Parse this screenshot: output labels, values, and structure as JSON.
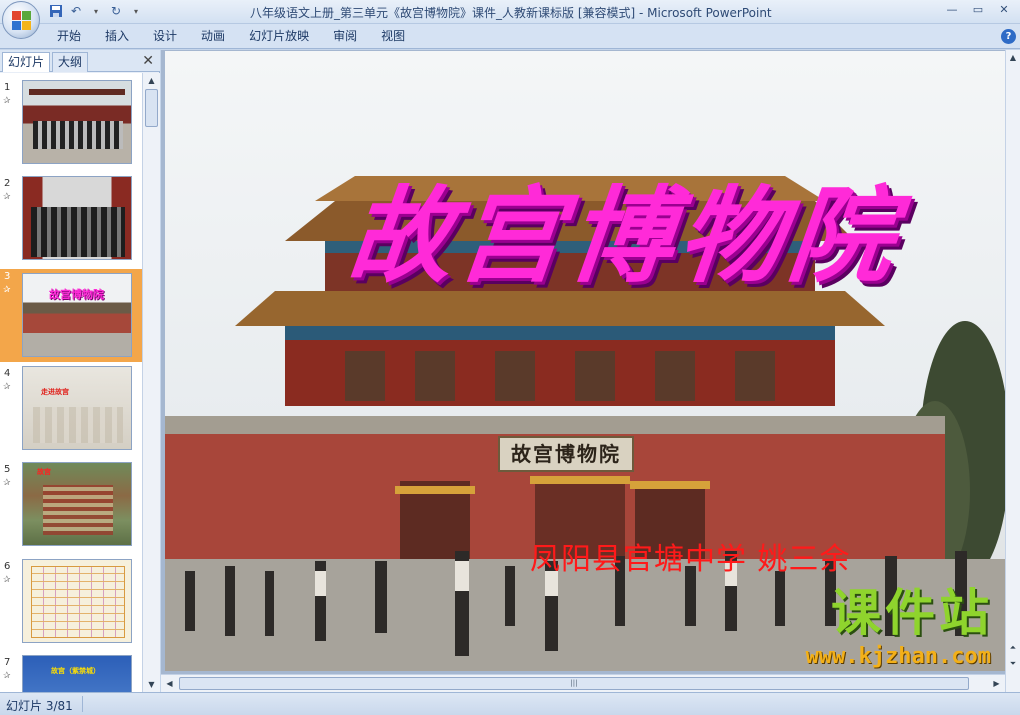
{
  "window": {
    "title": "八年级语文上册_第三单元《故宫博物院》课件_人教新课标版 [兼容模式] - Microsoft PowerPoint"
  },
  "ribbon": {
    "tabs": [
      "开始",
      "插入",
      "设计",
      "动画",
      "幻灯片放映",
      "审阅",
      "视图"
    ]
  },
  "panel": {
    "tab_slides": "幻灯片",
    "tab_outline": "大纲",
    "thumbnails": [
      {
        "num": "1",
        "caption": ""
      },
      {
        "num": "2",
        "caption": ""
      },
      {
        "num": "3",
        "caption": "故宫博物院",
        "selected": true
      },
      {
        "num": "4",
        "caption": "走进故宫"
      },
      {
        "num": "5",
        "caption": "故宫"
      },
      {
        "num": "6",
        "caption": ""
      },
      {
        "num": "7",
        "caption": "故宫（紫禁城）"
      }
    ]
  },
  "slide": {
    "title": "故宫博物院",
    "gate_sign": "故宫博物院",
    "author": "凤阳县官塘中学 姚三余"
  },
  "watermark": {
    "brand_cn": "课件站",
    "brand_url": "www.kjzhan.com"
  },
  "status": {
    "slide_indicator": "幻灯片 3/81"
  },
  "colors": {
    "title_magenta": "#ff2ad8",
    "author_red": "#ff1a1a",
    "selected_thumb": "#f3a64a"
  }
}
